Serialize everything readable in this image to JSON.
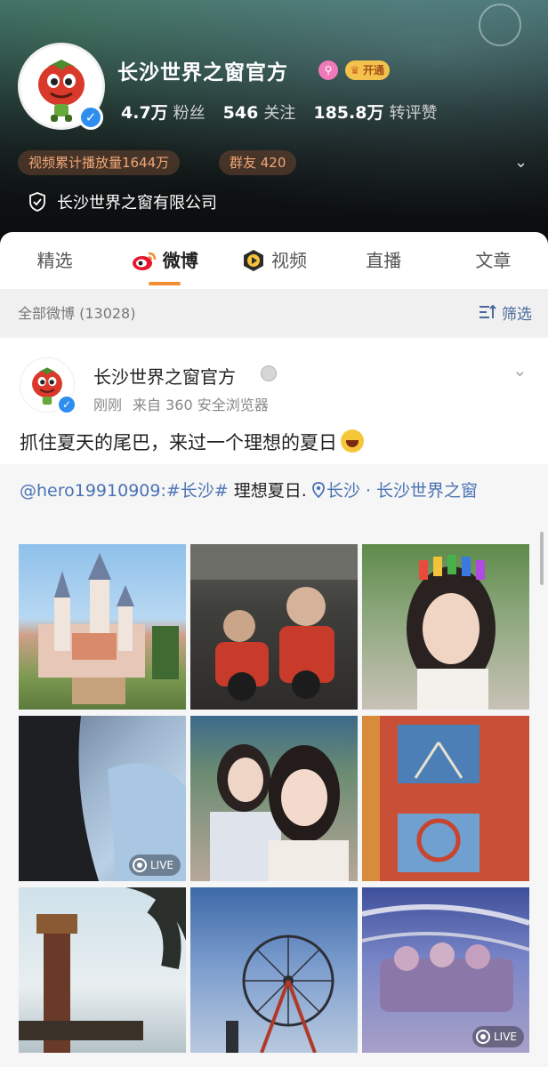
{
  "profile": {
    "name": "长沙世界之窗官方",
    "vip_label": "开通",
    "stats": [
      {
        "num": "4.7万",
        "label": "粉丝"
      },
      {
        "num": "546",
        "label": "关注"
      },
      {
        "num": "185.8万",
        "label": "转评赞"
      }
    ],
    "video_plays": "视频累计播放量1644万",
    "group": "群友 420",
    "company": "长沙世界之窗有限公司"
  },
  "tabs": [
    "精选",
    "微博",
    "视频",
    "直播",
    "文章"
  ],
  "filter_bar": {
    "all_label": "全部微博 (13028)",
    "filter_label": "筛选"
  },
  "post": {
    "author": "长沙世界之窗官方",
    "time": "刚刚",
    "source": "来自 360 安全浏览器",
    "text": "抓住夏天的尾巴，来过一个理想的夏日",
    "repost_user": "@hero19910909:",
    "repost_tag": "#长沙#",
    "repost_plain": " 理想夏日. ",
    "repost_location": "长沙 · 长沙世界之窗"
  },
  "images": [
    {
      "name": "castle-photo",
      "live": false
    },
    {
      "name": "bear-motorcycle-photo",
      "live": false
    },
    {
      "name": "girl-hairclips-photo",
      "live": false
    },
    {
      "name": "hair-shoulder-photo",
      "live": true,
      "live_label": "LIVE"
    },
    {
      "name": "two-girls-selfie-photo",
      "live": false
    },
    {
      "name": "posters-wall-photo",
      "live": false
    },
    {
      "name": "drop-tower-photo",
      "live": false
    },
    {
      "name": "ferris-wheel-photo",
      "live": false
    },
    {
      "name": "coaster-riders-photo",
      "live": true,
      "live_label": "LIVE"
    }
  ],
  "colors": {
    "accent": "#f28d32",
    "link": "#4a73b5",
    "verify": "#2d8ef0"
  }
}
